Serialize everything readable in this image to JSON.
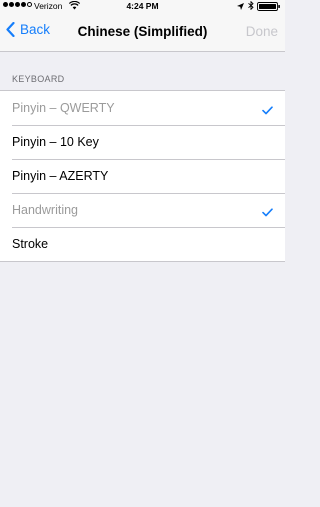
{
  "status_bar": {
    "carrier": "Verizon",
    "time": "4:24 PM",
    "signal_bars_filled": 4,
    "signal_bars_total": 5
  },
  "nav": {
    "back_label": "Back",
    "title": "Chinese (Simplified)",
    "done_label": "Done"
  },
  "keyboard_section": {
    "header": "KEYBOARD",
    "items": [
      {
        "label": "Pinyin – QWERTY",
        "checked": true,
        "disabled": true
      },
      {
        "label": "Pinyin – 10 Key",
        "checked": false,
        "disabled": false
      },
      {
        "label": "Pinyin – AZERTY",
        "checked": false,
        "disabled": false
      },
      {
        "label": "Handwriting",
        "checked": true,
        "disabled": true
      },
      {
        "label": "Stroke",
        "checked": false,
        "disabled": false
      }
    ]
  },
  "colors": {
    "accent": "#157efb",
    "disabled_text": "#9b9b9b",
    "background": "#efeff4"
  }
}
